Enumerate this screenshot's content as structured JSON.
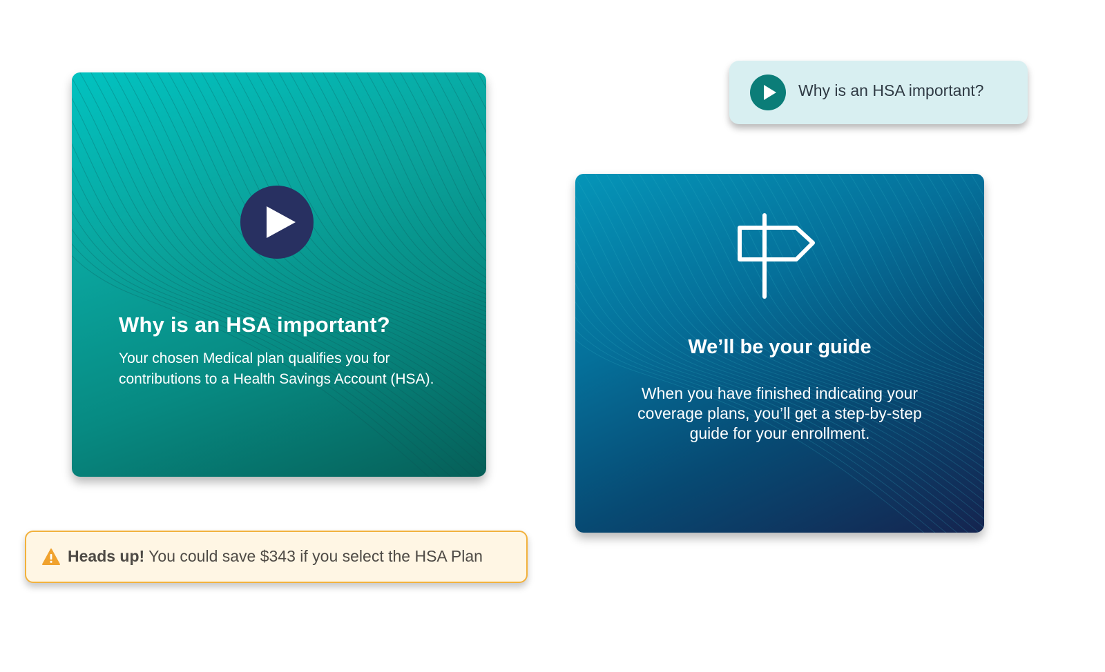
{
  "hsa_card": {
    "title": "Why is an HSA important?",
    "body": "Your chosen Medical plan qualifies you for contributions to a Health Savings Account (HSA).",
    "play_icon": "play-icon",
    "colors": {
      "gradient_start": "#02c2c0",
      "gradient_end": "#065f58",
      "play_circle": "#283061"
    }
  },
  "video_pill": {
    "label": "Why is an HSA important?",
    "play_icon": "play-icon",
    "colors": {
      "background": "#d8eff1",
      "icon": "#0b7d78"
    }
  },
  "guide_card": {
    "title": "We’ll be your guide",
    "body": "When you have finished indicating your coverage plans, you’ll get a step-by-step guide for your enrollment.",
    "icon": "signpost-icon",
    "colors": {
      "gradient_start": "#0595b8",
      "gradient_end": "#15244f"
    }
  },
  "alert": {
    "strong": "Heads up!",
    "message": "You could save $343 if you select the HSA Plan",
    "icon": "warning-icon",
    "colors": {
      "border": "#f2b13c",
      "background": "#fff6e4",
      "icon": "#f0a22e"
    }
  }
}
